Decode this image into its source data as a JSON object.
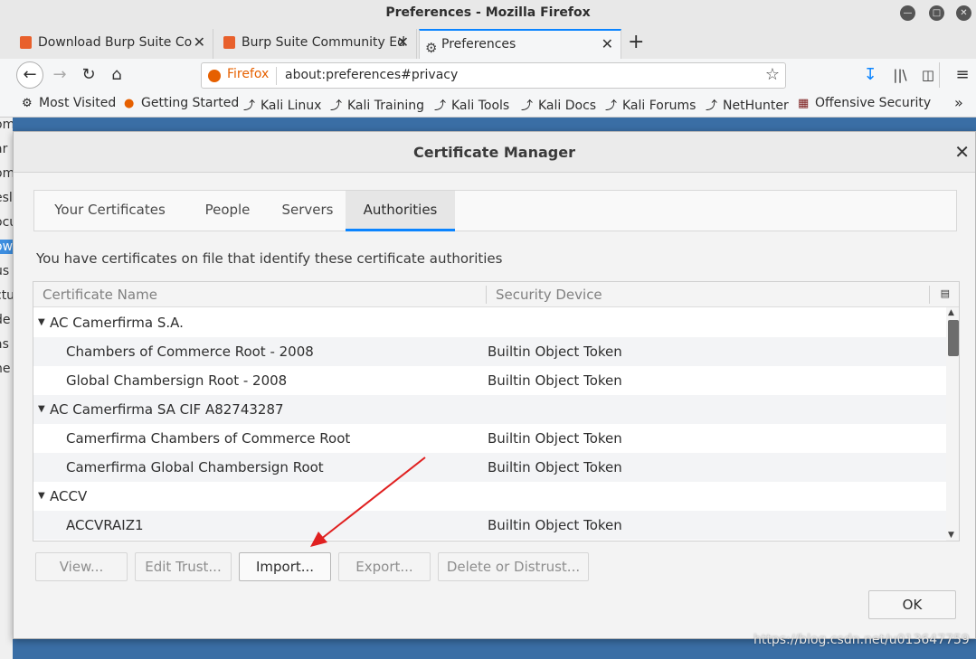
{
  "window": {
    "title": "Preferences - Mozilla Firefox"
  },
  "tabs": [
    {
      "label": "Download Burp Suite Co",
      "active": false
    },
    {
      "label": "Burp Suite Community Ed",
      "active": false
    },
    {
      "label": "Preferences",
      "active": true
    }
  ],
  "navbar": {
    "identity_label": "Firefox",
    "url": "about:preferences#privacy"
  },
  "bookmarks": [
    {
      "label": "Most Visited",
      "icon": "gear-icon"
    },
    {
      "label": "Getting Started",
      "icon": "firefox-icon"
    },
    {
      "label": "Kali Linux",
      "icon": "kali-dragon-icon"
    },
    {
      "label": "Kali Training",
      "icon": "kali-dragon-icon"
    },
    {
      "label": "Kali Tools",
      "icon": "kali-dragon-icon"
    },
    {
      "label": "Kali Docs",
      "icon": "kali-dragon-icon"
    },
    {
      "label": "Kali Forums",
      "icon": "kali-dragon-icon"
    },
    {
      "label": "NetHunter",
      "icon": "kali-dragon-icon"
    },
    {
      "label": "Offensive Security",
      "icon": "offsec-icon"
    }
  ],
  "left_strip_text": [
    "om",
    "ar",
    "om",
    "esl",
    "ocu",
    "ow",
    "us",
    "ctu",
    "de",
    "as",
    "he"
  ],
  "dialog": {
    "title": "Certificate Manager",
    "tabs": [
      {
        "label": "Your Certificates",
        "active": false
      },
      {
        "label": "People",
        "active": false
      },
      {
        "label": "Servers",
        "active": false
      },
      {
        "label": "Authorities",
        "active": true
      }
    ],
    "description": "You have certificates on file that identify these certificate authorities",
    "columns": {
      "name": "Certificate Name",
      "device": "Security Device"
    },
    "rows": [
      {
        "type": "group",
        "name": "AC Camerfirma S.A.",
        "device": ""
      },
      {
        "type": "cert",
        "name": "Chambers of Commerce Root - 2008",
        "device": "Builtin Object Token"
      },
      {
        "type": "cert",
        "name": "Global Chambersign Root - 2008",
        "device": "Builtin Object Token"
      },
      {
        "type": "group",
        "name": "AC Camerfirma SA CIF A82743287",
        "device": ""
      },
      {
        "type": "cert",
        "name": "Camerfirma Chambers of Commerce Root",
        "device": "Builtin Object Token"
      },
      {
        "type": "cert",
        "name": "Camerfirma Global Chambersign Root",
        "device": "Builtin Object Token"
      },
      {
        "type": "group",
        "name": "ACCV",
        "device": ""
      },
      {
        "type": "cert",
        "name": "ACCVRAIZ1",
        "device": "Builtin Object Token"
      }
    ],
    "buttons": {
      "view": "View...",
      "edit_trust": "Edit Trust...",
      "import": "Import...",
      "export": "Export...",
      "delete": "Delete or Distrust...",
      "ok": "OK"
    }
  },
  "watermark": "https://blog.csdn.net/u013647759",
  "colors": {
    "accent": "#0a84ff",
    "arrow": "#e02020",
    "identity": "#e66000"
  }
}
